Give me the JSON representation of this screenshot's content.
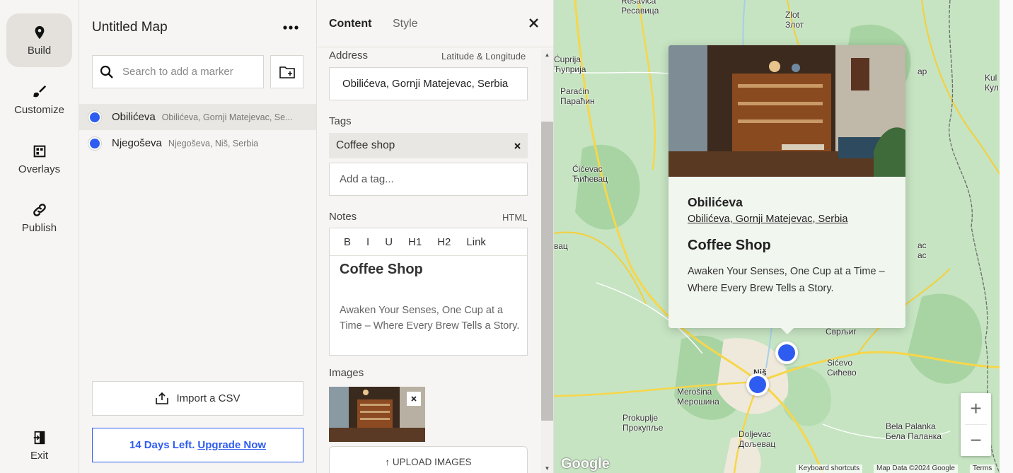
{
  "rail": {
    "build": "Build",
    "customize": "Customize",
    "overlays": "Overlays",
    "publish": "Publish",
    "exit": "Exit"
  },
  "list": {
    "title": "Untitled Map",
    "search_placeholder": "Search to add a marker",
    "markers": [
      {
        "name": "Obilićeva",
        "address": "Obilićeva, Gornji Matejevac, Se...",
        "color": "#2f5cf0",
        "selected": true
      },
      {
        "name": "Njegoševa",
        "address": "Njegoševa, Niš, Serbia",
        "color": "#2f5cf0",
        "selected": false
      }
    ],
    "import_label": "Import a CSV",
    "upgrade_prefix": "14 Days Left.",
    "upgrade_link": "Upgrade Now"
  },
  "editor": {
    "tab_content": "Content",
    "tab_style": "Style",
    "address_label": "Address",
    "latlng_label": "Latitude & Longitude",
    "address_value": "Obilićeva, Gornji Matejevac, Serbia",
    "tags_label": "Tags",
    "tag": "Coffee shop",
    "tag_placeholder": "Add a tag...",
    "notes_label": "Notes",
    "notes_html": "HTML",
    "toolbar": [
      "B",
      "I",
      "U",
      "H1",
      "H2",
      "Link"
    ],
    "notes_heading": "Coffee Shop",
    "notes_body": "Awaken Your Senses, One Cup at a Time – Where Every Brew Tells a Story.",
    "images_label": "Images",
    "upload_label": "↑ UPLOAD IMAGES"
  },
  "map": {
    "popup_title": "Obilićeva",
    "popup_address": "Obilićeva, Gornji Matejevac, Serbia",
    "popup_heading": "Coffee Shop",
    "popup_body": "Awaken Your Senses, One Cup at a Time – Where Every Brew Tells a Story.",
    "places": {
      "resavica": "Resavica\nРесавица",
      "zlot": "Zlot\nЗлот",
      "cuprija": "Ćuprija\nЋуприја",
      "paracin": "Paraćin\nПараћин",
      "cicevac": "Ćićevac\nЋићевац",
      "nis": "Niš",
      "svrljig": "Сврљиг",
      "sicevo": "Sićevo\nСићево",
      "merosina": "Merošina\nМерошина",
      "prokuplje": "Prokuplje\nПрокупље",
      "doljevac": "Doljevac\nДољевац",
      "bela_palanka": "Bela Palanka\nБела Паланка",
      "kul": "Kul\nКул",
      "frag1": "ap",
      "frag2": "ac\nac",
      "frag3": "вац"
    },
    "google": "Google",
    "shortcuts": "Keyboard shortcuts",
    "mapdata": "Map Data ©2024 Google",
    "terms": "Terms",
    "zoom_in": "+",
    "zoom_out": "−"
  }
}
